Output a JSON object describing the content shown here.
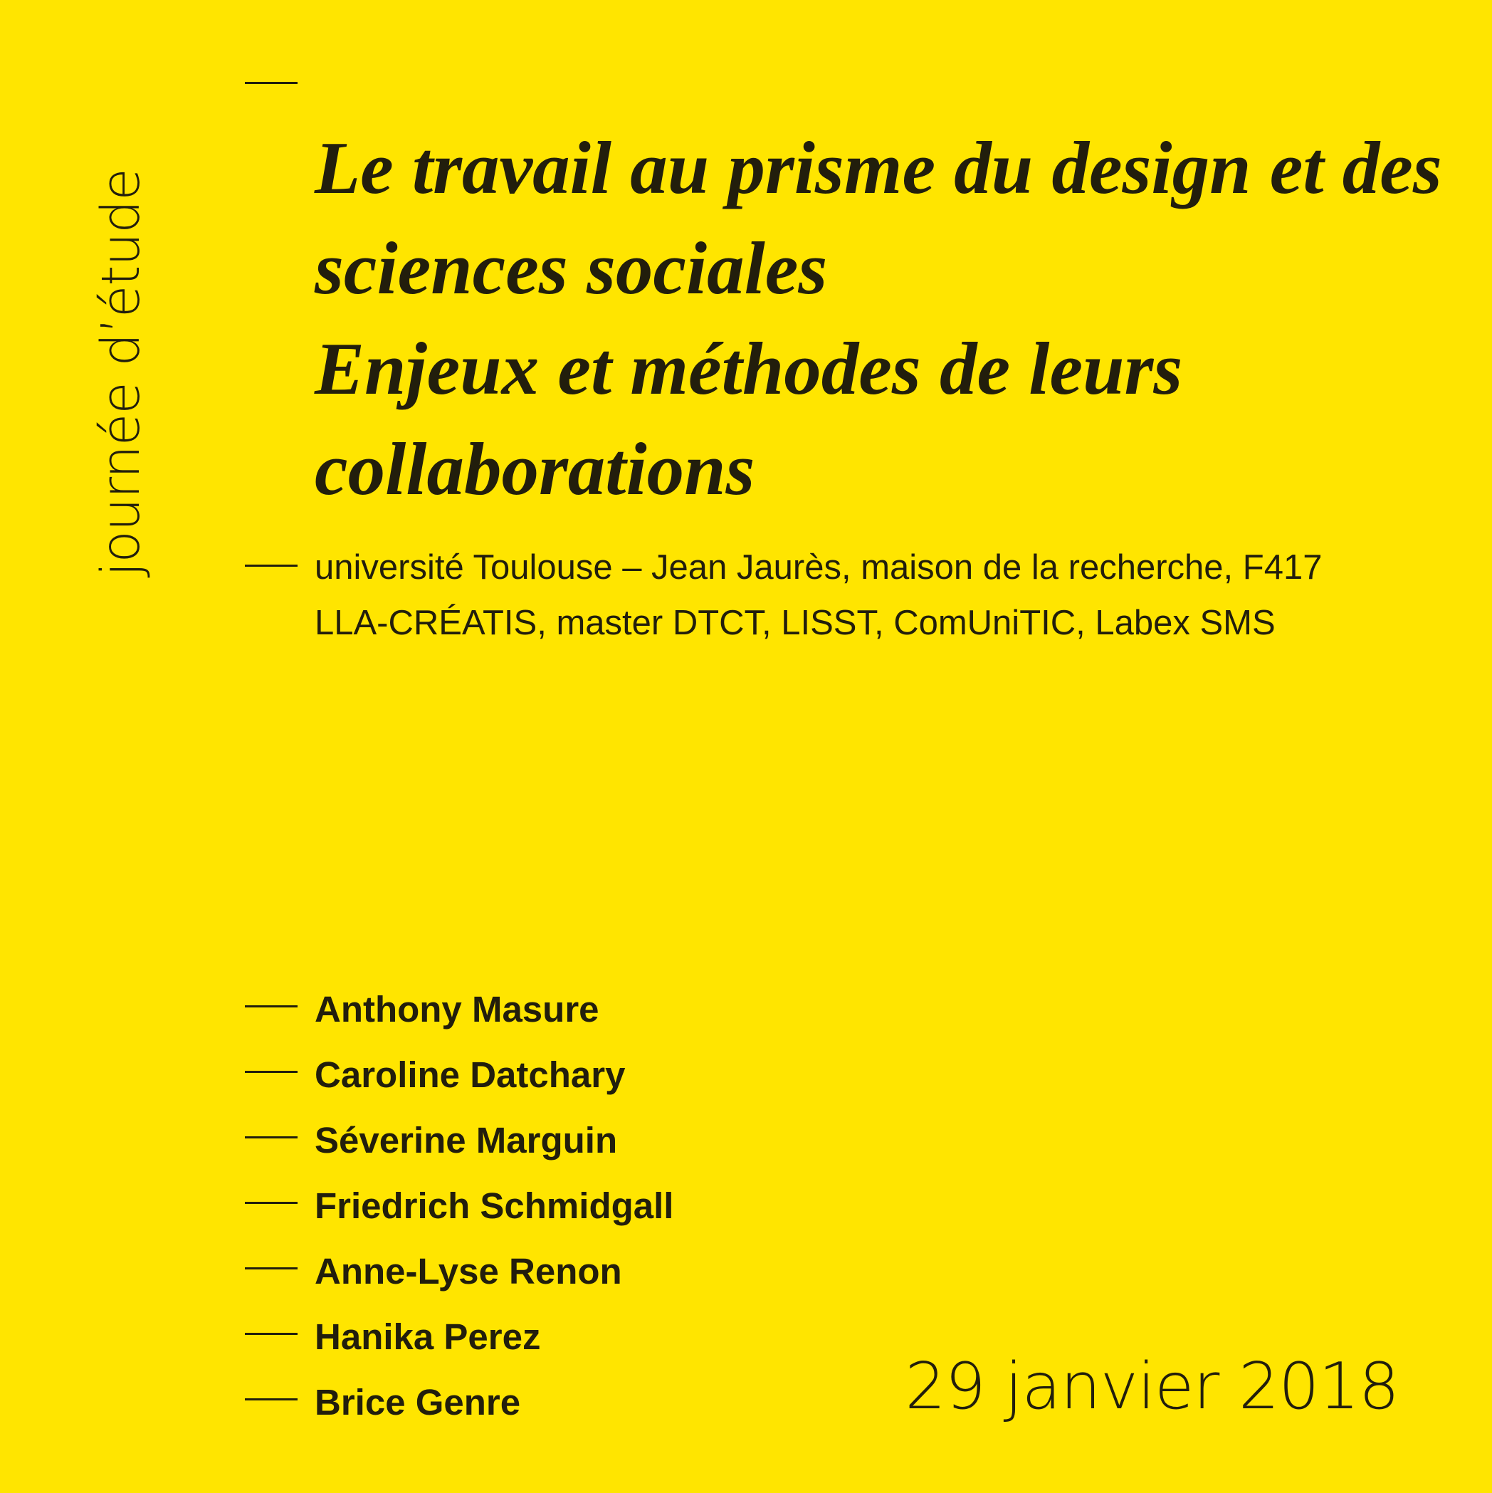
{
  "side_label": "journée d’étude",
  "title": "Le travail au prisme du design et des sciences sociales",
  "subtitle": "Enjeux et méthodes de leurs collaborations",
  "venue": {
    "location": "université Toulouse – Jean Jaurès, maison de la recherche, F417",
    "organizers": "LLA-CRÉATIS, master DTCT, LISST, ComUniTIC, Labex SMS"
  },
  "speakers": [
    "Anthony Masure",
    "Caroline Datchary",
    "Séverine Marguin",
    "Friedrich Schmidgall",
    "Anne-Lyse Renon",
    "Hanika Perez",
    "Brice Genre"
  ],
  "date": "29 janvier 2018",
  "colors": {
    "background": "#FFE500",
    "text": "#221E0C"
  }
}
